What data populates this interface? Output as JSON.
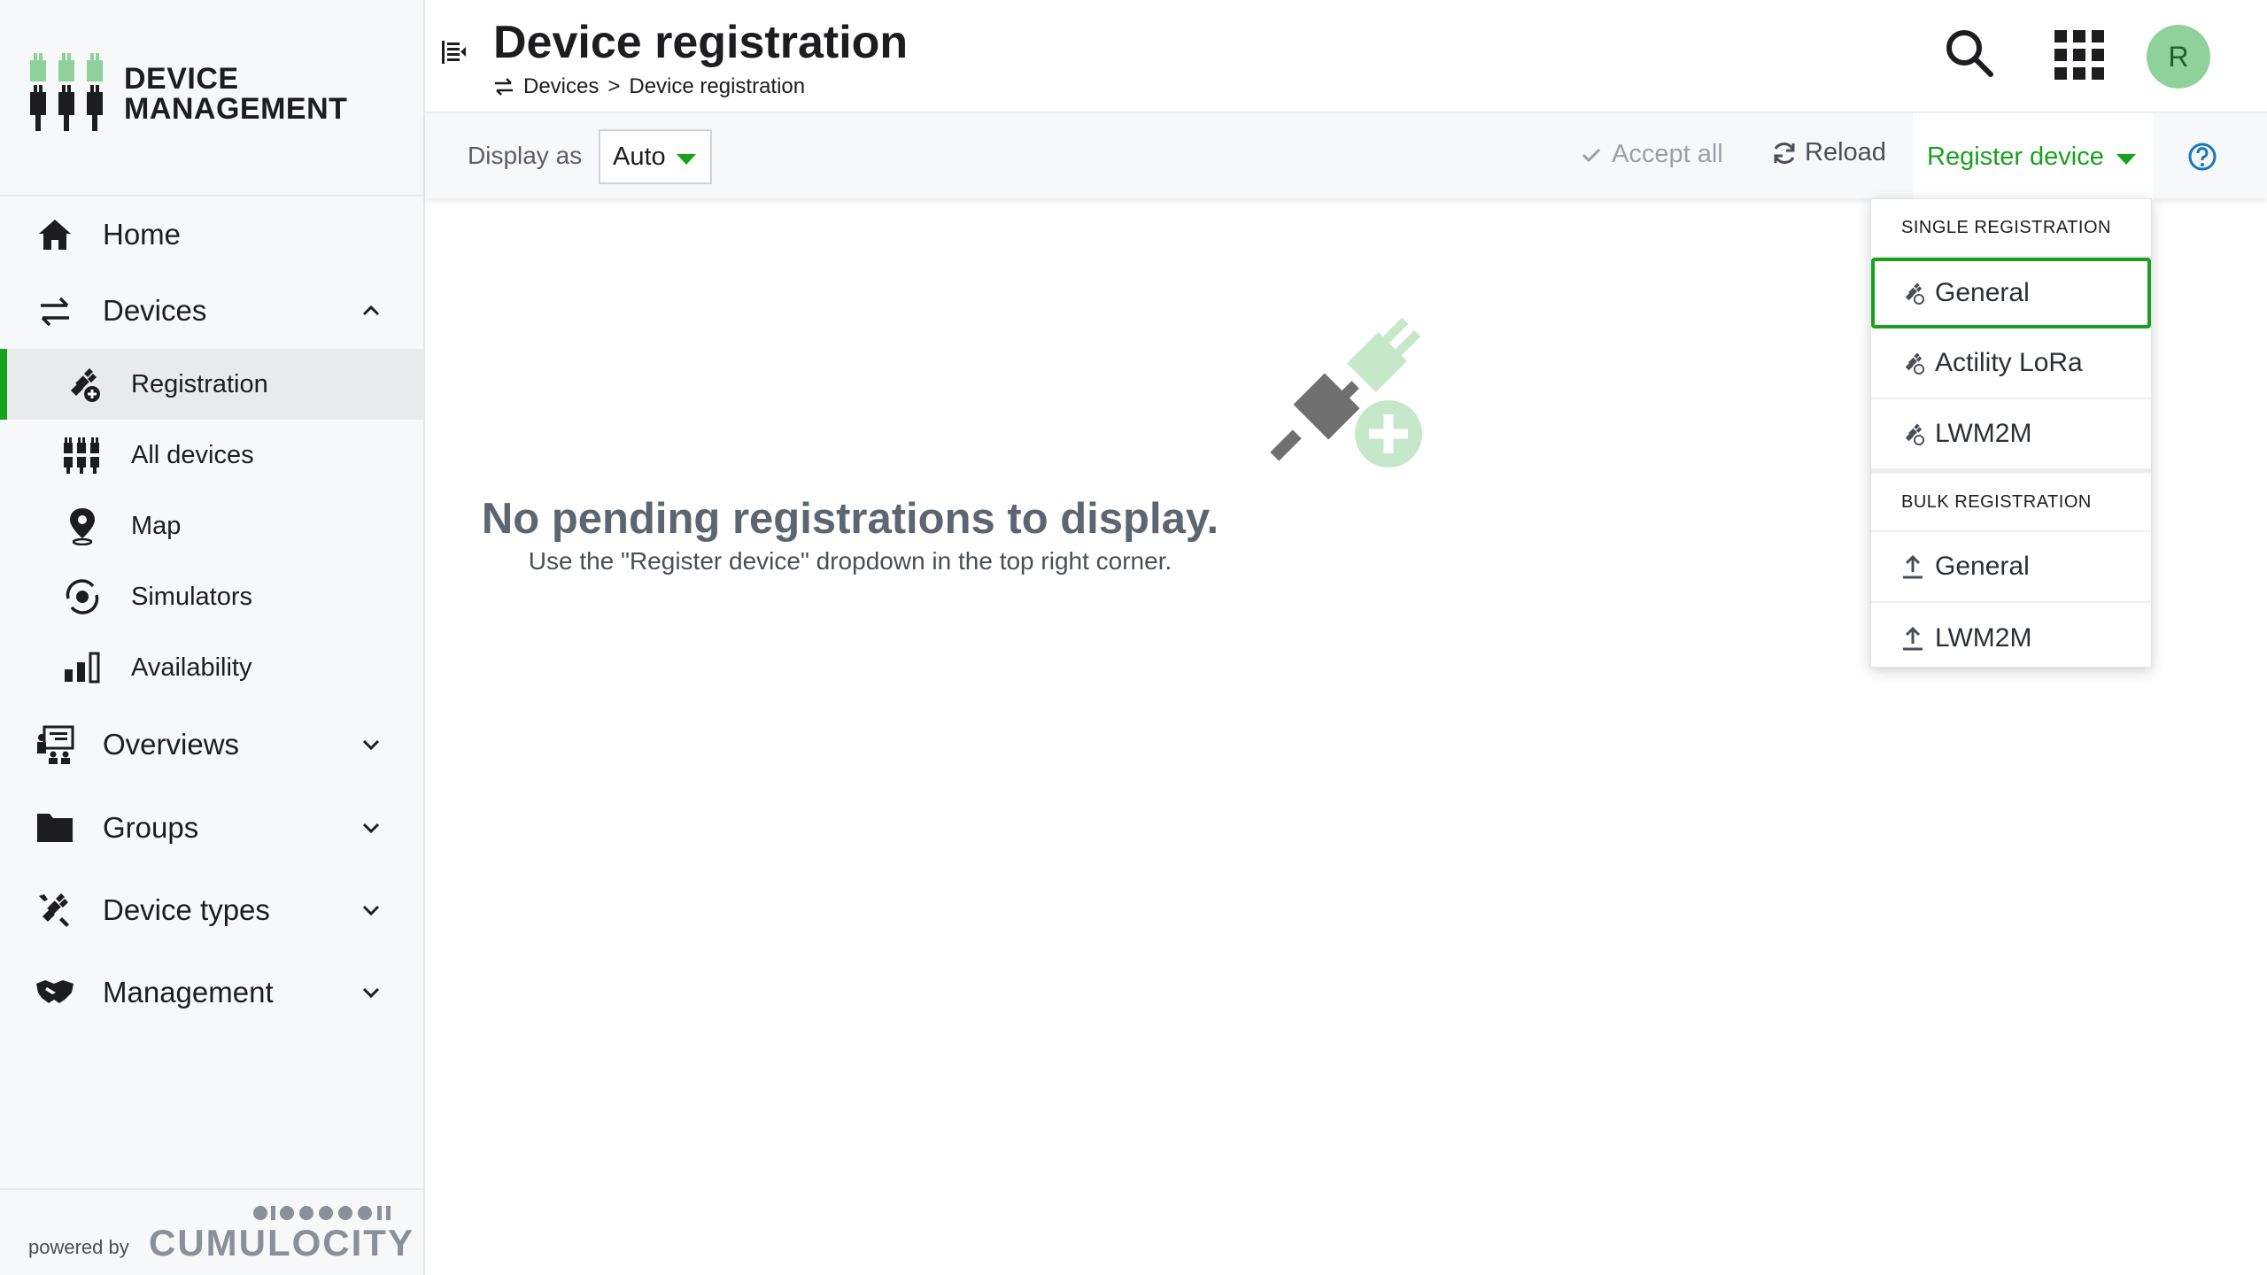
{
  "brand": {
    "line1": "DEVICE",
    "line2": "MANAGEMENT",
    "accent_color": "#8fd19a"
  },
  "sidebar": {
    "items": [
      {
        "label": "Home",
        "icon": "home-icon"
      },
      {
        "label": "Devices",
        "icon": "transfer-arrows-icon",
        "expanded": true,
        "children": [
          {
            "label": "Registration",
            "icon": "plug-add-icon",
            "active": true
          },
          {
            "label": "All devices",
            "icon": "device-array-icon"
          },
          {
            "label": "Map",
            "icon": "map-pin-icon"
          },
          {
            "label": "Simulators",
            "icon": "simulator-icon"
          },
          {
            "label": "Availability",
            "icon": "availability-bars-icon"
          }
        ]
      },
      {
        "label": "Overviews",
        "icon": "overviews-icon"
      },
      {
        "label": "Groups",
        "icon": "folder-icon"
      },
      {
        "label": "Device types",
        "icon": "plug-tools-icon"
      },
      {
        "label": "Management",
        "icon": "handshake-icon"
      }
    ],
    "powered_by": "powered by",
    "powered_brand": "CUMULOCITY"
  },
  "header": {
    "title": "Device registration",
    "breadcrumb": [
      "Devices",
      "Device registration"
    ],
    "breadcrumb_separator": ">",
    "avatar_initial": "R"
  },
  "toolbar": {
    "display_as_label": "Display as",
    "display_as_value": "Auto",
    "accept_all": "Accept all",
    "reload": "Reload",
    "register_device": "Register device",
    "accent_color": "#1aa01f"
  },
  "dropdown": {
    "single_header": "SINGLE REGISTRATION",
    "single_items": [
      "General",
      "Actility LoRa",
      "LWM2M"
    ],
    "bulk_header": "BULK REGISTRATION",
    "bulk_items": [
      "General",
      "LWM2M"
    ]
  },
  "empty_state": {
    "title": "No pending registrations to display.",
    "subtitle": "Use the \"Register device\" dropdown in the top right corner."
  }
}
